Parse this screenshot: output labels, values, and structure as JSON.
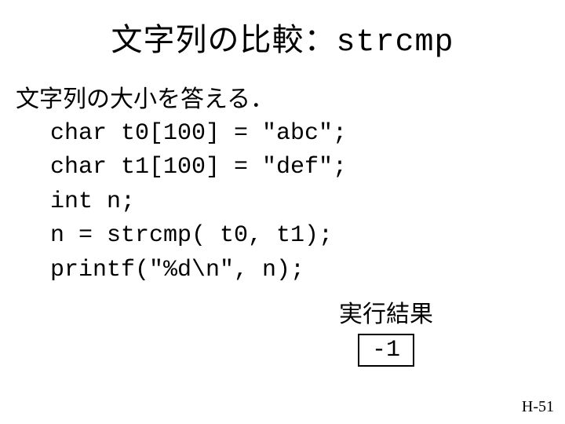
{
  "title": {
    "jp": "文字列の比較：",
    "mono": "strcmp"
  },
  "lead": "文字列の大小を答える．",
  "code": {
    "l1": "char t0[100] = \"abc\";",
    "l2": "char t1[100] = \"def\";",
    "l3": "int n;",
    "l4": "n = strcmp( t0, t1);",
    "l5": "printf(\"%d\\n\", n);"
  },
  "result": {
    "label": "実行結果",
    "value": "-1"
  },
  "page": "H-51"
}
